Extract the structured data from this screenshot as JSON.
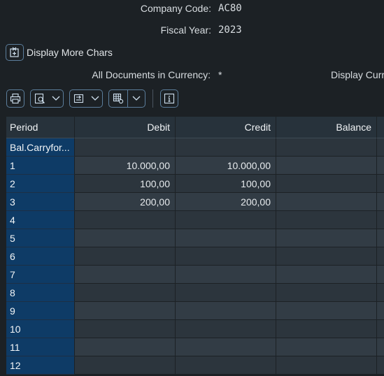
{
  "header": {
    "company_code_label": "Company Code:",
    "company_code_value": "AC80",
    "fiscal_year_label": "Fiscal Year:",
    "fiscal_year_value": "2023",
    "display_more_chars": "Display More Chars",
    "all_docs_label": "All Documents in Currency:",
    "all_docs_value": "*",
    "display_currency_label": "Display Curr"
  },
  "table": {
    "columns": [
      "Period",
      "Debit",
      "Credit",
      "Balance"
    ],
    "rows": [
      {
        "period": "Bal.Carryfor...",
        "debit": "",
        "credit": "",
        "balance": ""
      },
      {
        "period": "1",
        "debit": "10.000,00",
        "credit": "10.000,00",
        "balance": ""
      },
      {
        "period": "2",
        "debit": "100,00",
        "credit": "100,00",
        "balance": ""
      },
      {
        "period": "3",
        "debit": "200,00",
        "credit": "200,00",
        "balance": ""
      },
      {
        "period": "4",
        "debit": "",
        "credit": "",
        "balance": ""
      },
      {
        "period": "5",
        "debit": "",
        "credit": "",
        "balance": ""
      },
      {
        "period": "6",
        "debit": "",
        "credit": "",
        "balance": ""
      },
      {
        "period": "7",
        "debit": "",
        "credit": "",
        "balance": ""
      },
      {
        "period": "8",
        "debit": "",
        "credit": "",
        "balance": ""
      },
      {
        "period": "9",
        "debit": "",
        "credit": "",
        "balance": ""
      },
      {
        "period": "10",
        "debit": "",
        "credit": "",
        "balance": ""
      },
      {
        "period": "11",
        "debit": "",
        "credit": "",
        "balance": ""
      },
      {
        "period": "12",
        "debit": "",
        "credit": "",
        "balance": ""
      }
    ]
  },
  "toolbar": {
    "icons": [
      "print-icon",
      "find-icon",
      "export-icon",
      "layout-icon",
      "info-icon"
    ]
  },
  "colors": {
    "background": "#1c2125",
    "period_column": "#0e3b66",
    "header_row": "#27323b",
    "button_border": "#5c7e9c"
  }
}
